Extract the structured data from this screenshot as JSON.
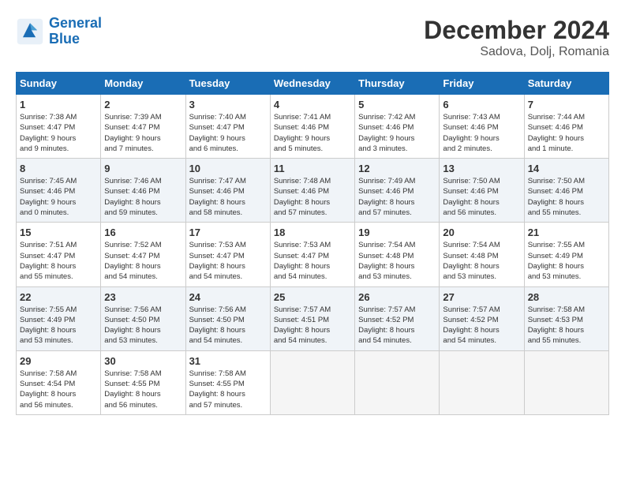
{
  "header": {
    "logo_line1": "General",
    "logo_line2": "Blue",
    "month": "December 2024",
    "location": "Sadova, Dolj, Romania"
  },
  "weekdays": [
    "Sunday",
    "Monday",
    "Tuesday",
    "Wednesday",
    "Thursday",
    "Friday",
    "Saturday"
  ],
  "weeks": [
    [
      {
        "day": "1",
        "info": "Sunrise: 7:38 AM\nSunset: 4:47 PM\nDaylight: 9 hours\nand 9 minutes."
      },
      {
        "day": "2",
        "info": "Sunrise: 7:39 AM\nSunset: 4:47 PM\nDaylight: 9 hours\nand 7 minutes."
      },
      {
        "day": "3",
        "info": "Sunrise: 7:40 AM\nSunset: 4:47 PM\nDaylight: 9 hours\nand 6 minutes."
      },
      {
        "day": "4",
        "info": "Sunrise: 7:41 AM\nSunset: 4:46 PM\nDaylight: 9 hours\nand 5 minutes."
      },
      {
        "day": "5",
        "info": "Sunrise: 7:42 AM\nSunset: 4:46 PM\nDaylight: 9 hours\nand 3 minutes."
      },
      {
        "day": "6",
        "info": "Sunrise: 7:43 AM\nSunset: 4:46 PM\nDaylight: 9 hours\nand 2 minutes."
      },
      {
        "day": "7",
        "info": "Sunrise: 7:44 AM\nSunset: 4:46 PM\nDaylight: 9 hours\nand 1 minute."
      }
    ],
    [
      {
        "day": "8",
        "info": "Sunrise: 7:45 AM\nSunset: 4:46 PM\nDaylight: 9 hours\nand 0 minutes."
      },
      {
        "day": "9",
        "info": "Sunrise: 7:46 AM\nSunset: 4:46 PM\nDaylight: 8 hours\nand 59 minutes."
      },
      {
        "day": "10",
        "info": "Sunrise: 7:47 AM\nSunset: 4:46 PM\nDaylight: 8 hours\nand 58 minutes."
      },
      {
        "day": "11",
        "info": "Sunrise: 7:48 AM\nSunset: 4:46 PM\nDaylight: 8 hours\nand 57 minutes."
      },
      {
        "day": "12",
        "info": "Sunrise: 7:49 AM\nSunset: 4:46 PM\nDaylight: 8 hours\nand 57 minutes."
      },
      {
        "day": "13",
        "info": "Sunrise: 7:50 AM\nSunset: 4:46 PM\nDaylight: 8 hours\nand 56 minutes."
      },
      {
        "day": "14",
        "info": "Sunrise: 7:50 AM\nSunset: 4:46 PM\nDaylight: 8 hours\nand 55 minutes."
      }
    ],
    [
      {
        "day": "15",
        "info": "Sunrise: 7:51 AM\nSunset: 4:47 PM\nDaylight: 8 hours\nand 55 minutes."
      },
      {
        "day": "16",
        "info": "Sunrise: 7:52 AM\nSunset: 4:47 PM\nDaylight: 8 hours\nand 54 minutes."
      },
      {
        "day": "17",
        "info": "Sunrise: 7:53 AM\nSunset: 4:47 PM\nDaylight: 8 hours\nand 54 minutes."
      },
      {
        "day": "18",
        "info": "Sunrise: 7:53 AM\nSunset: 4:47 PM\nDaylight: 8 hours\nand 54 minutes."
      },
      {
        "day": "19",
        "info": "Sunrise: 7:54 AM\nSunset: 4:48 PM\nDaylight: 8 hours\nand 53 minutes."
      },
      {
        "day": "20",
        "info": "Sunrise: 7:54 AM\nSunset: 4:48 PM\nDaylight: 8 hours\nand 53 minutes."
      },
      {
        "day": "21",
        "info": "Sunrise: 7:55 AM\nSunset: 4:49 PM\nDaylight: 8 hours\nand 53 minutes."
      }
    ],
    [
      {
        "day": "22",
        "info": "Sunrise: 7:55 AM\nSunset: 4:49 PM\nDaylight: 8 hours\nand 53 minutes."
      },
      {
        "day": "23",
        "info": "Sunrise: 7:56 AM\nSunset: 4:50 PM\nDaylight: 8 hours\nand 53 minutes."
      },
      {
        "day": "24",
        "info": "Sunrise: 7:56 AM\nSunset: 4:50 PM\nDaylight: 8 hours\nand 54 minutes."
      },
      {
        "day": "25",
        "info": "Sunrise: 7:57 AM\nSunset: 4:51 PM\nDaylight: 8 hours\nand 54 minutes."
      },
      {
        "day": "26",
        "info": "Sunrise: 7:57 AM\nSunset: 4:52 PM\nDaylight: 8 hours\nand 54 minutes."
      },
      {
        "day": "27",
        "info": "Sunrise: 7:57 AM\nSunset: 4:52 PM\nDaylight: 8 hours\nand 54 minutes."
      },
      {
        "day": "28",
        "info": "Sunrise: 7:58 AM\nSunset: 4:53 PM\nDaylight: 8 hours\nand 55 minutes."
      }
    ],
    [
      {
        "day": "29",
        "info": "Sunrise: 7:58 AM\nSunset: 4:54 PM\nDaylight: 8 hours\nand 56 minutes."
      },
      {
        "day": "30",
        "info": "Sunrise: 7:58 AM\nSunset: 4:55 PM\nDaylight: 8 hours\nand 56 minutes."
      },
      {
        "day": "31",
        "info": "Sunrise: 7:58 AM\nSunset: 4:55 PM\nDaylight: 8 hours\nand 57 minutes."
      },
      {
        "day": "",
        "info": ""
      },
      {
        "day": "",
        "info": ""
      },
      {
        "day": "",
        "info": ""
      },
      {
        "day": "",
        "info": ""
      }
    ]
  ]
}
